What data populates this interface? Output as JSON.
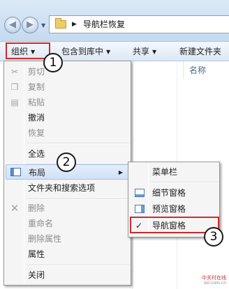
{
  "address_bar": {
    "back_glyph": "◀",
    "forward_glyph": "▶",
    "path_separator": "▶",
    "path": "导航栏恢复"
  },
  "toolbar": {
    "organize": "组织",
    "include_in_library": "包含到库中",
    "share": "共享",
    "new_folder": "新建文件夹",
    "dropdown_arrow": "▼"
  },
  "content": {
    "column_name": "名称"
  },
  "context_menu": {
    "items": [
      {
        "label": "剪切",
        "enabled": false,
        "icon": "scissors-icon"
      },
      {
        "label": "复制",
        "enabled": false,
        "icon": "copy-icon"
      },
      {
        "label": "粘贴",
        "enabled": false,
        "icon": "paste-icon"
      },
      {
        "label": "撤消",
        "enabled": true
      },
      {
        "label": "恢复",
        "enabled": false
      },
      {
        "label": "全选",
        "enabled": true
      },
      {
        "label": "布局",
        "enabled": true,
        "highlighted": true,
        "icon": "layout-icon",
        "has_submenu": true
      },
      {
        "label": "文件夹和搜索选项",
        "enabled": true
      },
      {
        "label": "删除",
        "enabled": false,
        "icon": "delete-x-icon"
      },
      {
        "label": "重命名",
        "enabled": false
      },
      {
        "label": "删除属性",
        "enabled": false
      },
      {
        "label": "属性",
        "enabled": true
      },
      {
        "label": "关闭",
        "enabled": true
      }
    ],
    "submenu_arrow": "▶"
  },
  "layout_submenu": {
    "items": [
      {
        "label": "菜单栏"
      },
      {
        "label": "细节窗格",
        "icon": "details-pane-icon"
      },
      {
        "label": "预览窗格",
        "icon": "preview-pane-icon"
      },
      {
        "label": "导航窗格",
        "checked": true,
        "check_glyph": "✓"
      }
    ]
  },
  "callouts": [
    "1",
    "2",
    "3"
  ],
  "watermark": {
    "brand": "中关村在线",
    "url": "zol.com.cn"
  },
  "colors": {
    "annotation_red": "#d32a2a",
    "menu_bg": "#f5f5f5",
    "highlight": "#cfe1f7"
  }
}
